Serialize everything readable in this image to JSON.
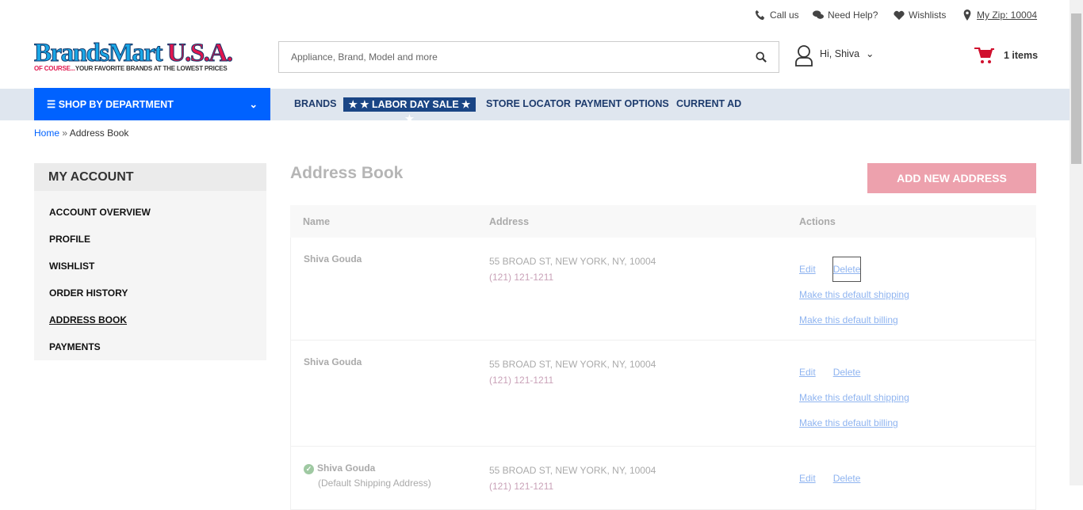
{
  "util": {
    "call": "Call us",
    "help": "Need Help?",
    "wishlists": "Wishlists",
    "zip": "My Zip: 10004"
  },
  "logo": {
    "brand": "BrandsMart",
    "usa": "U.S.A.",
    "tag_red": "OF COURSE...",
    "tag": "YOUR FAVORITE BRANDS AT THE LOWEST PRICES"
  },
  "search": {
    "placeholder": "Appliance, Brand, Model and more"
  },
  "user": {
    "greeting": "Hi, Shiva"
  },
  "cart": {
    "count": "1 items"
  },
  "nav": {
    "shop": "SHOP BY DEPARTMENT",
    "brands": "BRANDS",
    "sale": "★ ★ LABOR DAY SALE ★ ★",
    "store": "STORE LOCATOR",
    "payment": "PAYMENT OPTIONS",
    "ad": "CURRENT AD"
  },
  "breadcrumb": {
    "home": "Home",
    "sep": "»",
    "current": "Address Book"
  },
  "sidebar": {
    "title": "MY ACCOUNT",
    "items": [
      {
        "label": "ACCOUNT OVERVIEW"
      },
      {
        "label": "PROFILE"
      },
      {
        "label": "WISHLIST"
      },
      {
        "label": "ORDER HISTORY"
      },
      {
        "label": "ADDRESS BOOK"
      },
      {
        "label": "PAYMENTS"
      }
    ]
  },
  "main": {
    "title": "Address Book",
    "add": "ADD NEW ADDRESS",
    "cols": [
      "Name",
      "Address",
      "Actions"
    ],
    "rows": [
      {
        "name": "Shiva Gouda",
        "address": "55 BROAD ST, NEW YORK, NY, 10004",
        "phone": "(121) 121-1211",
        "edit": "Edit",
        "delete": "Delete",
        "ship": "Make this default shipping",
        "bill": "Make this default billing"
      },
      {
        "name": "Shiva Gouda",
        "address": "55 BROAD ST, NEW YORK, NY, 10004",
        "phone": "(121) 121-1211",
        "edit": "Edit",
        "delete": "Delete",
        "ship": "Make this default shipping",
        "bill": "Make this default billing"
      },
      {
        "name": "Shiva Gouda",
        "note": "(Default Shipping Address)",
        "address": "55 BROAD ST, NEW YORK, NY, 10004",
        "phone": "(121) 121-1211",
        "edit": "Edit",
        "delete": "Delete"
      }
    ]
  }
}
